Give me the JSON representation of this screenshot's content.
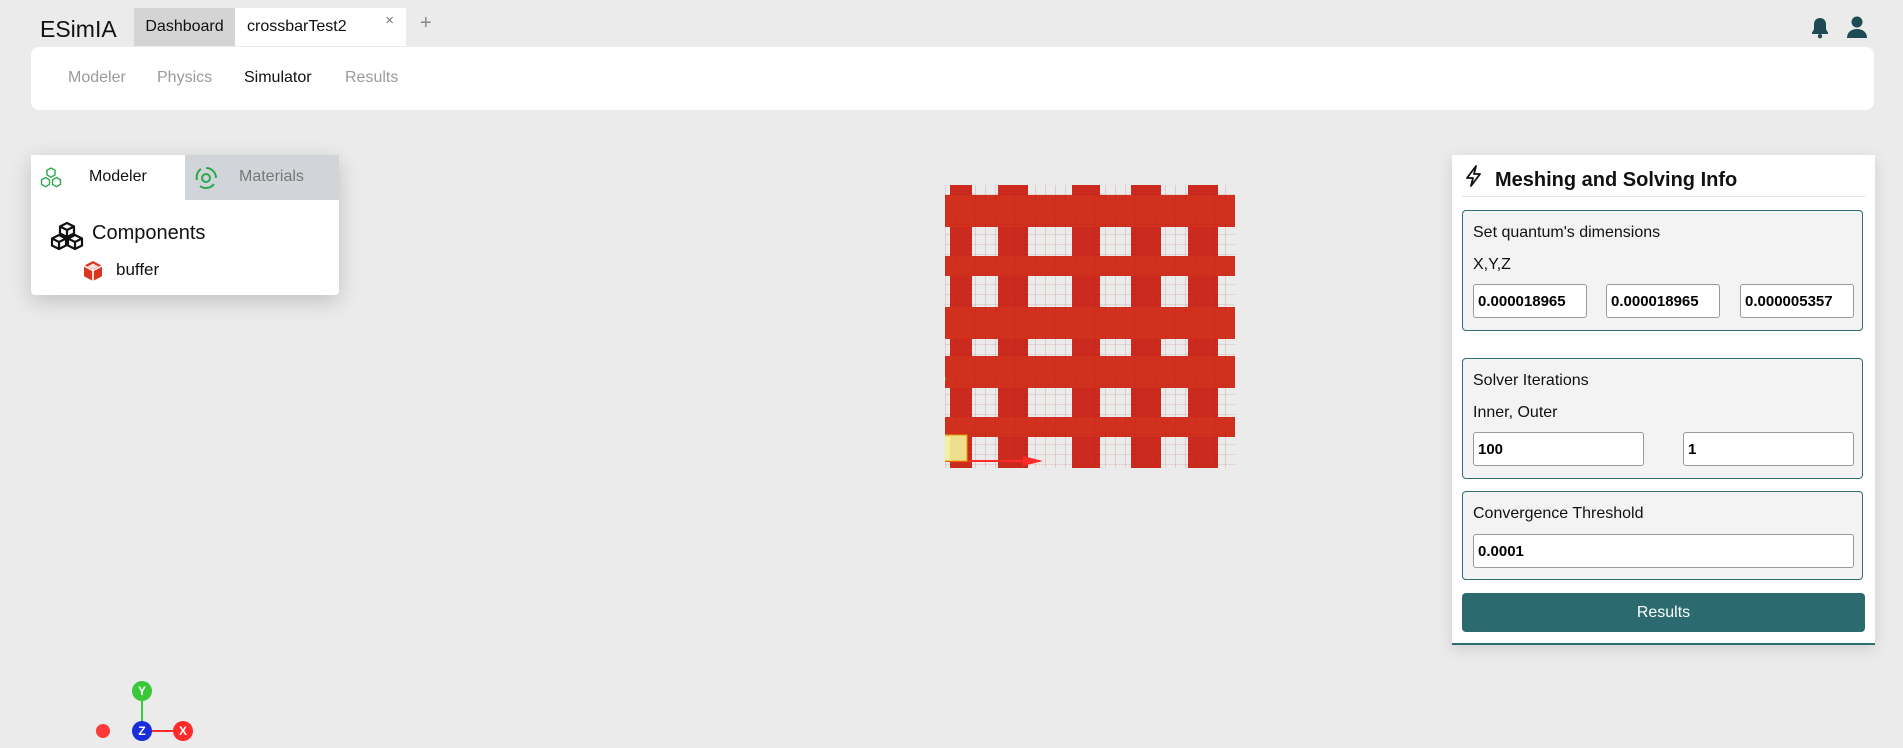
{
  "app": {
    "title": "ESimIA"
  },
  "tabs": [
    {
      "label": "Dashboard"
    },
    {
      "label": "crossbarTest2",
      "close": "×"
    }
  ],
  "add_tab": "+",
  "nav": {
    "items": [
      "Modeler",
      "Physics",
      "Simulator",
      "Results"
    ],
    "active": "Simulator"
  },
  "left_panel": {
    "tabs": [
      {
        "label": "Modeler"
      },
      {
        "label": "Materials"
      }
    ],
    "tree": {
      "group": "Components",
      "items": [
        "buffer"
      ]
    }
  },
  "axes_gizmo": {
    "y": "Y",
    "z": "Z",
    "x": "X"
  },
  "meshing_panel": {
    "title": "Meshing and Solving Info",
    "quantum": {
      "label": "Set quantum's dimensions",
      "sublabel": "X,Y,Z",
      "x": "0.000018965",
      "y": "0.000018965",
      "z": "0.000005357"
    },
    "solver": {
      "label": "Solver Iterations",
      "sublabel": "Inner, Outer",
      "inner": "100",
      "outer": "1"
    },
    "convergence": {
      "label": "Convergence Threshold",
      "value": "0.0001"
    },
    "results_button": "Results"
  },
  "colors": {
    "accent": "#2b6b70",
    "model": "#cc2a1e",
    "icon_green": "#2aa84a",
    "buffer_icon": "#d9361e"
  }
}
